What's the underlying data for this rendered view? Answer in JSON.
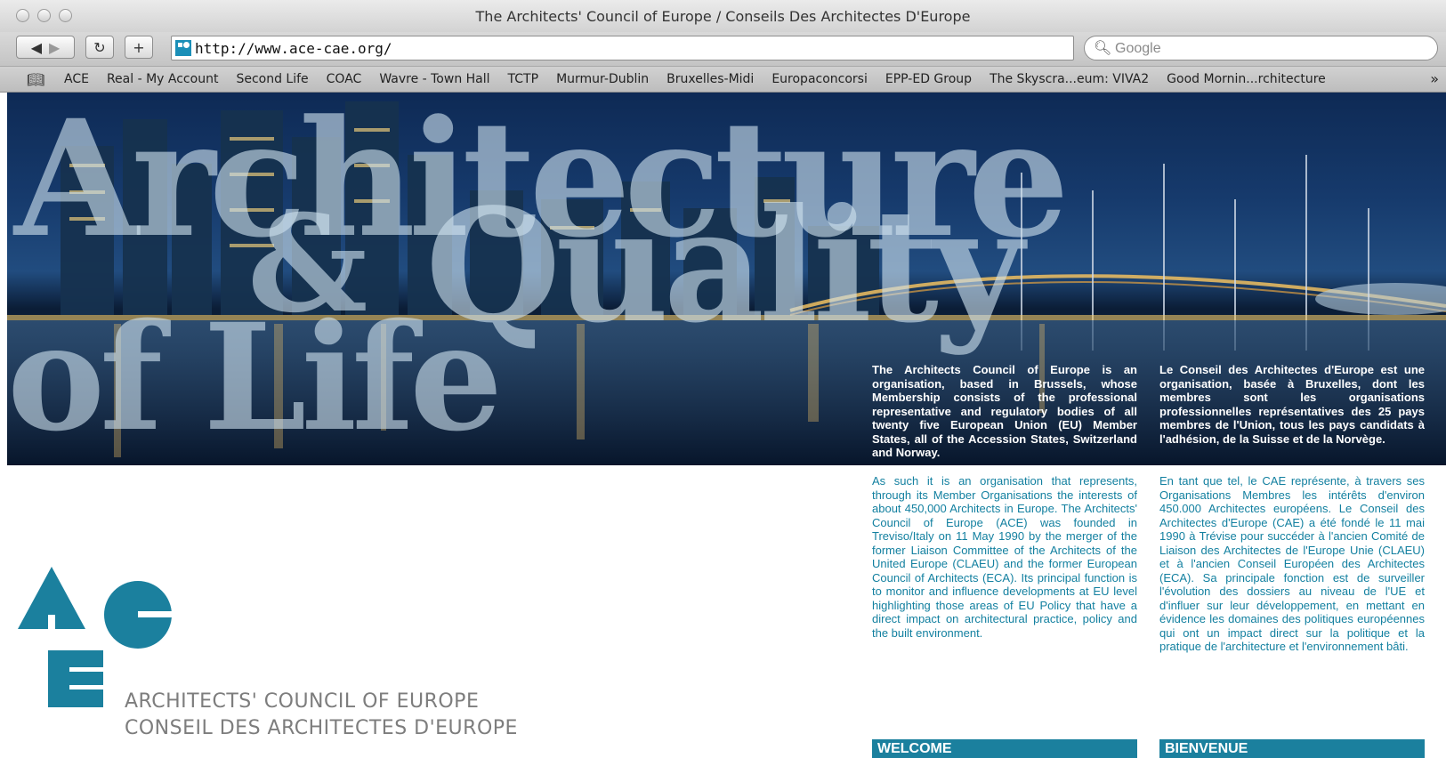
{
  "window": {
    "title": "The Architects' Council of Europe / Conseils Des Architectes D'Europe"
  },
  "toolbar": {
    "back_icon": "back-arrow-icon",
    "forward_icon": "forward-arrow-icon",
    "reload_icon": "reload-icon",
    "add_icon": "add-bookmark-icon",
    "url": "http://www.ace-cae.org/",
    "search_placeholder": "Google"
  },
  "bookmarks": {
    "items": [
      "ACE",
      "Real - My Account",
      "Second Life",
      "COAC",
      "Wavre - Town Hall",
      "TCTP",
      "Murmur-Dublin",
      "Bruxelles-Midi",
      "Europaconcorsi",
      "EPP-ED Group",
      "The Skyscra...eum: VIVA2",
      "Good Mornin...rchitecture"
    ],
    "more_label": "»"
  },
  "hero": {
    "words": [
      "Architecture",
      "&",
      "Quality",
      "of Life"
    ],
    "intro_en": "The Architects Council of Europe is an organisation, based in Brussels, whose Membership consists of the professional representative and regulatory bodies of all twenty five European Union (EU) Member States, all of the Accession States, Switzerland and Norway.",
    "intro_fr": "Le Conseil des Architectes d'Europe est une organisation, basée à Bruxelles, dont les membres sont les organisations professionnelles représentatives des 25 pays membres de l'Union, tous les pays candidats à l'adhésion, de la Suisse et de la Norvège."
  },
  "body": {
    "text_en": "As such it is an organisation that represents, through its Member Organisations the interests of about 450,000 Architects in Europe. The Architects' Council of Europe (ACE) was founded in Treviso/Italy on 11 May 1990 by the merger of the former Liaison Committee of the Architects of the United Europe (CLAEU) and the former European Council of Architects (ECA). Its principal function is to monitor and influence developments at EU level highlighting those areas of EU Policy that have a direct impact on architectural practice, policy and the built environment.",
    "text_fr": "En tant que tel, le CAE représente, à travers ses Organisations Membres les intérêts d'environ 450.000 Architectes européens. Le Conseil des Architectes d'Europe (CAE) a été fondé le 11 mai 1990 à Trévise pour succéder à l'ancien Comité de Liaison des Architectes de l'Europe Unie (CLAEU) et à l'ancien Conseil Européen des Architectes (ECA). Sa principale fonction est de surveiller l'évolution des dossiers au niveau de l'UE et d'influer sur leur développement, en mettant en évidence les domaines des politiques européennes qui ont un impact direct sur la politique et la pratique de l'architecture et l'environnement bâti."
  },
  "logo": {
    "org_en": "ARCHITECTS' COUNCIL OF EUROPE",
    "org_fr": "CONSEIL DES ARCHITECTES D'EUROPE",
    "color": "#1b809e"
  },
  "sections": {
    "welcome": "WELCOME",
    "bienvenue": "BIENVENUE"
  }
}
